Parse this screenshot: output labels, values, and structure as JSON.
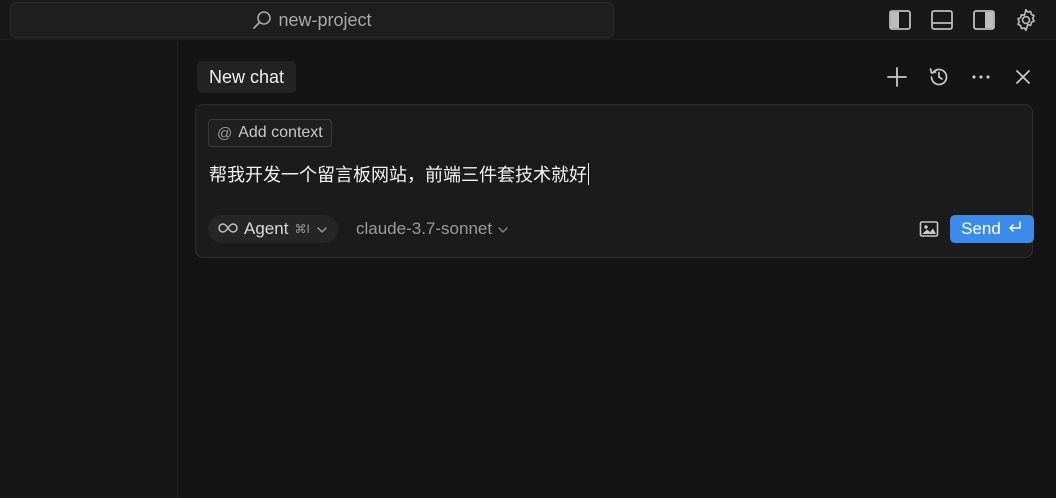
{
  "titlebar": {
    "search_label": "new-project",
    "icons": [
      "sidebar-left-icon",
      "panel-bottom-icon",
      "sidebar-right-icon",
      "gear-icon"
    ]
  },
  "chat": {
    "tab_label": "New chat",
    "actions": [
      "plus-icon",
      "history-icon",
      "more-icon",
      "close-icon"
    ]
  },
  "composer": {
    "add_context_label": "Add context",
    "prompt_text": "帮我开发一个留言板网站，前端三件套技术就好",
    "mode_label": "Agent",
    "mode_shortcut": "⌘I",
    "model_label": "claude-3.7-sonnet",
    "send_label": "Send"
  },
  "colors": {
    "background": "#141414",
    "accent": "#3b8bea"
  }
}
